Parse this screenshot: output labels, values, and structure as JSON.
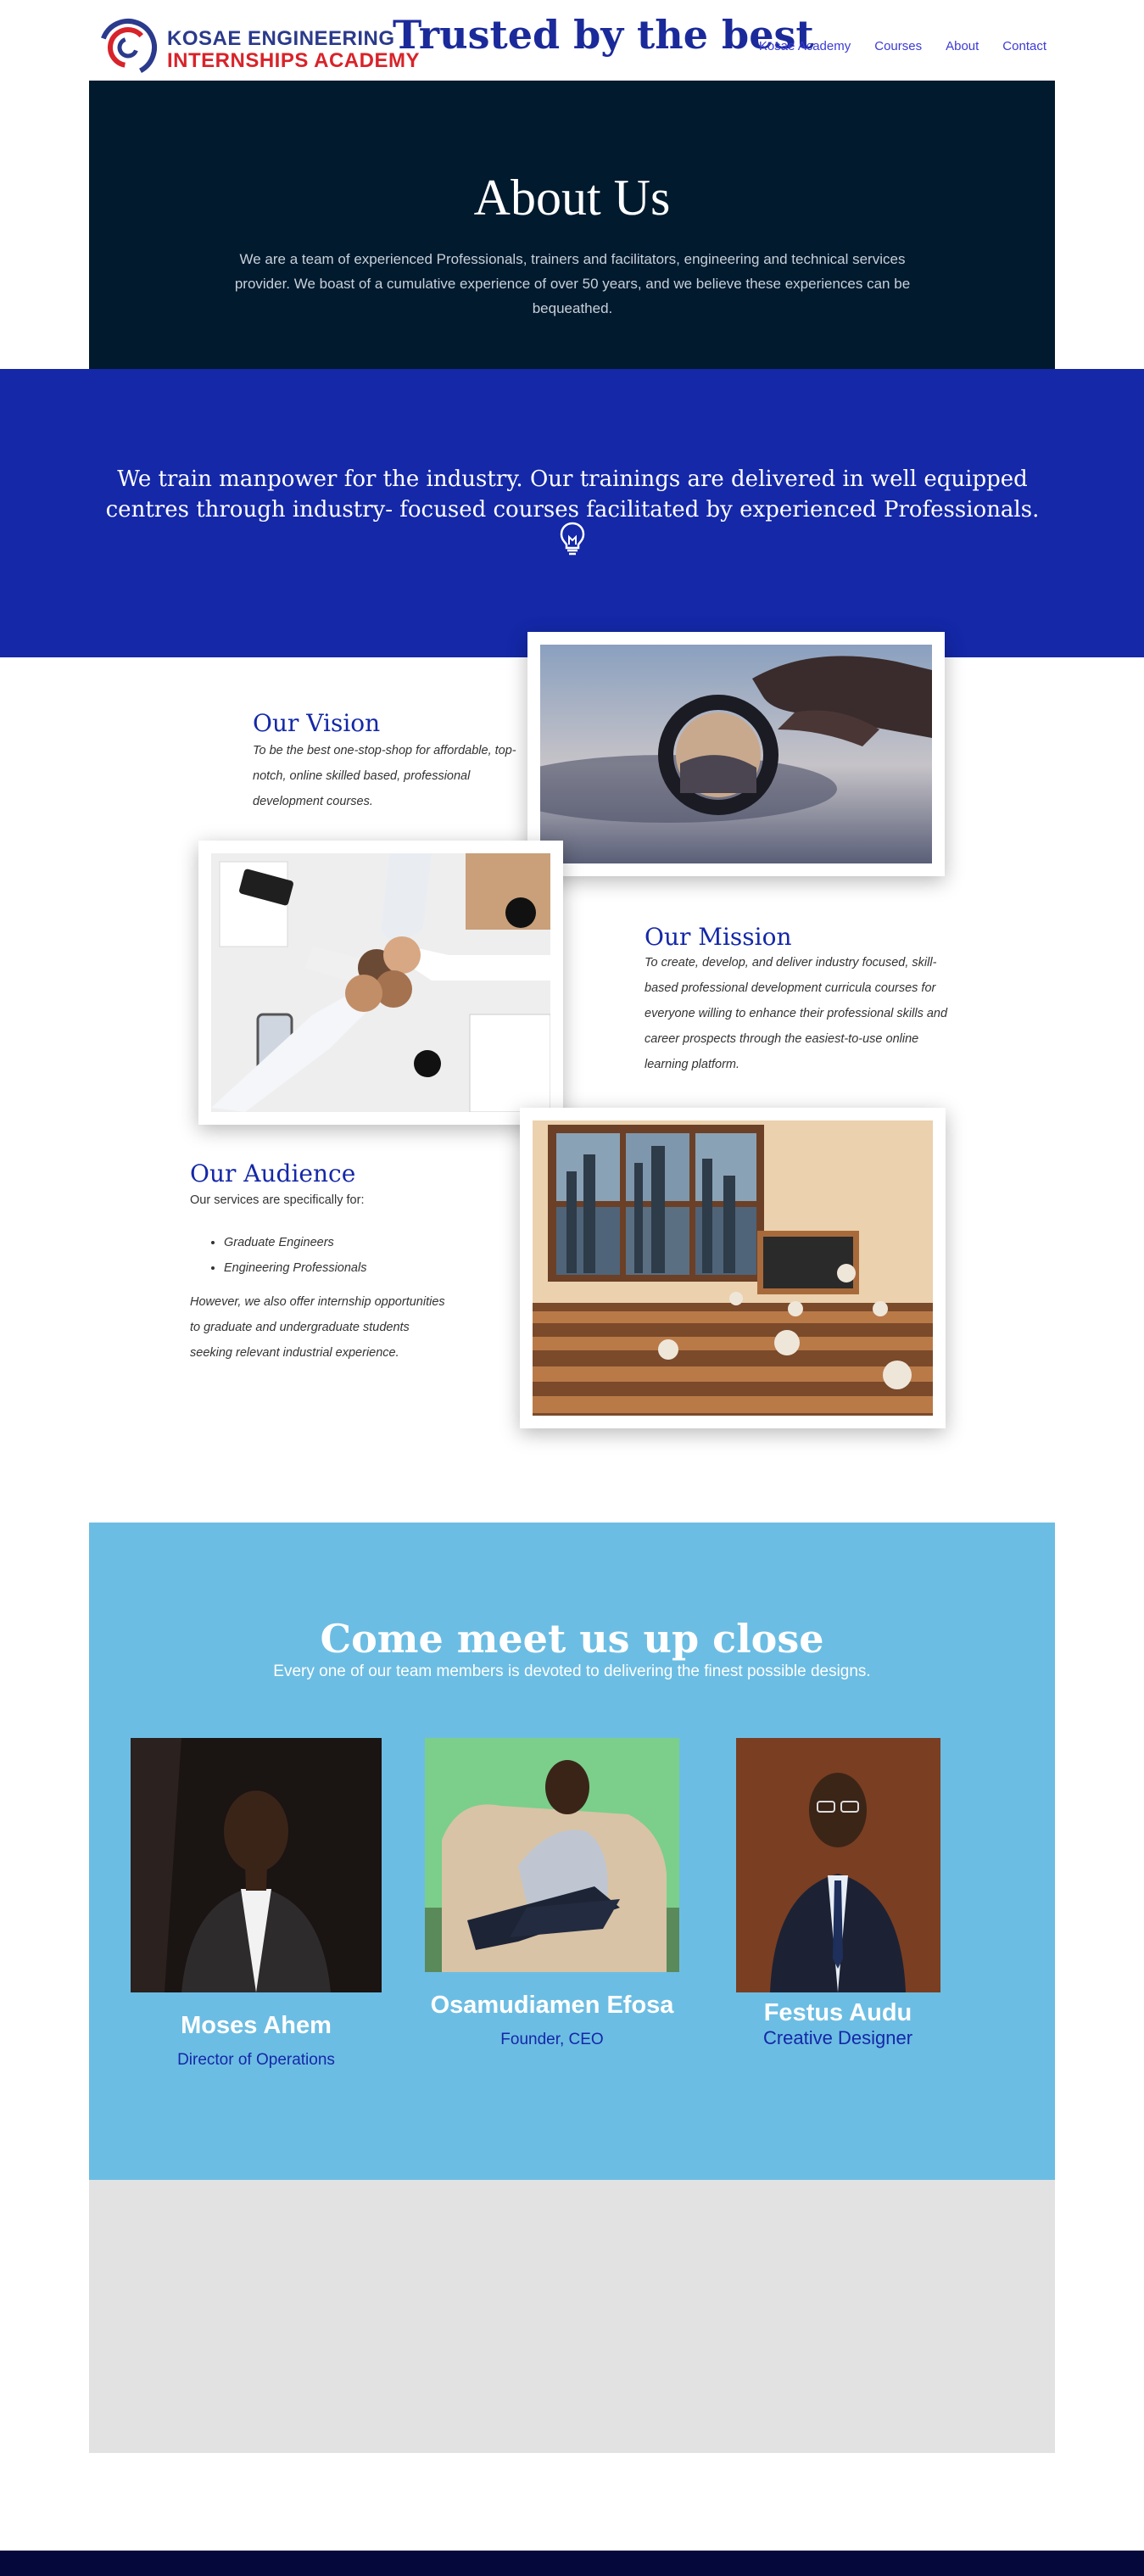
{
  "header": {
    "logo_line1": "KOSAE ENGINEERING",
    "logo_line2": "INTERNSHIPS ACADEMY",
    "tagline": "Trusted by the best",
    "nav": [
      "Kosae Academy",
      "Courses",
      "About",
      "Contact"
    ]
  },
  "about": {
    "title": "About Us",
    "text": "We are a team of experienced Professionals, trainers and facilitators, engineering and technical services provider. We boast of a cumulative experience of over 50 years, and we believe  these experiences can be bequeathed."
  },
  "band": {
    "text": "We train manpower for the industry. Our trainings are delivered in well equipped centres through industry- focused courses facilitated by experienced Professionals.",
    "icon": "lightbulb-icon"
  },
  "vision": {
    "title": "Our Vision",
    "text": "To be the best one-stop-shop for affordable, top-notch, online skilled based, professional development courses."
  },
  "mission": {
    "title": "Our Mission",
    "text": "To create, develop, and deliver industry focused, skill-based professional development curricula courses for everyone willing to enhance their professional skills and career prospects through the easiest-to-use online learning platform."
  },
  "audience": {
    "title": "Our Audience",
    "intro": "Our services are specifically for:",
    "items": [
      "Graduate Engineers",
      "Engineering Professionals"
    ],
    "outro": "However, we also offer internship opportunities to graduate and undergraduate students seeking relevant industrial experience."
  },
  "team": {
    "title": "Come meet us up close",
    "subtitle": "Every one of our team members is devoted to delivering the finest possible designs.",
    "members": [
      {
        "name": "Moses Ahem",
        "role": "Director of Operations"
      },
      {
        "name": "Osamudiamen Efosa",
        "role": "Founder, CEO"
      },
      {
        "name": "Festus Audu",
        "role": "Creative Designer"
      }
    ]
  },
  "colors": {
    "navy": "#011a2e",
    "royal_blue": "#1428a8",
    "sky_blue": "#6cbde3",
    "logo_red": "#d8232a",
    "footer": "#05083a"
  }
}
